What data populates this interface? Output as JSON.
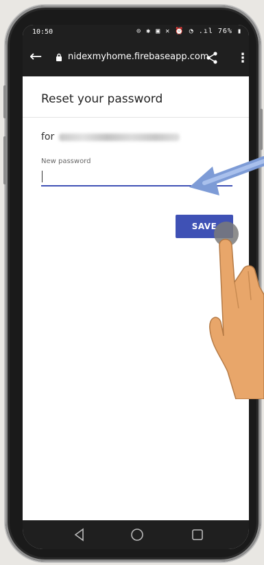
{
  "status_bar": {
    "time": "10:50",
    "icons_text": "⊙ ✱ ▣ ✕ ⏰ ◔ .ıl 76% ▮",
    "battery": "76%"
  },
  "browser": {
    "url": "nidexmyhome.firebaseapp.com",
    "back_icon": "back-arrow-icon",
    "lock_icon": "lock-icon",
    "share_icon": "share-icon",
    "menu_icon": "more-vert-icon"
  },
  "page": {
    "title": "Reset your password",
    "for_label": "for",
    "password_label": "New password",
    "password_value": "",
    "save_label": "SAVE",
    "accent_color": "#3f51b5"
  },
  "nav": {
    "back_icon": "nav-back-icon",
    "home_icon": "nav-home-icon",
    "recents_icon": "nav-recents-icon"
  }
}
